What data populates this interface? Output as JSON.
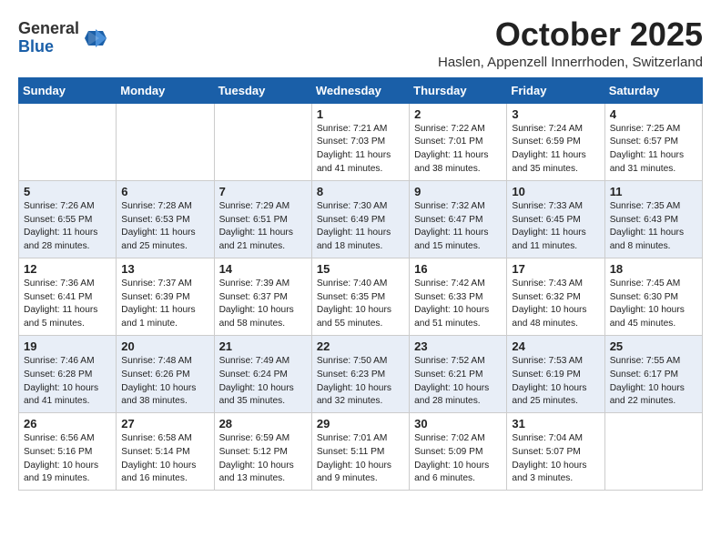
{
  "header": {
    "logo_general": "General",
    "logo_blue": "Blue",
    "month_title": "October 2025",
    "subtitle": "Haslen, Appenzell Innerrhoden, Switzerland"
  },
  "days_of_week": [
    "Sunday",
    "Monday",
    "Tuesday",
    "Wednesday",
    "Thursday",
    "Friday",
    "Saturday"
  ],
  "weeks": [
    [
      {
        "day": "",
        "content": ""
      },
      {
        "day": "",
        "content": ""
      },
      {
        "day": "",
        "content": ""
      },
      {
        "day": "1",
        "content": "Sunrise: 7:21 AM\nSunset: 7:03 PM\nDaylight: 11 hours and 41 minutes."
      },
      {
        "day": "2",
        "content": "Sunrise: 7:22 AM\nSunset: 7:01 PM\nDaylight: 11 hours and 38 minutes."
      },
      {
        "day": "3",
        "content": "Sunrise: 7:24 AM\nSunset: 6:59 PM\nDaylight: 11 hours and 35 minutes."
      },
      {
        "day": "4",
        "content": "Sunrise: 7:25 AM\nSunset: 6:57 PM\nDaylight: 11 hours and 31 minutes."
      }
    ],
    [
      {
        "day": "5",
        "content": "Sunrise: 7:26 AM\nSunset: 6:55 PM\nDaylight: 11 hours and 28 minutes."
      },
      {
        "day": "6",
        "content": "Sunrise: 7:28 AM\nSunset: 6:53 PM\nDaylight: 11 hours and 25 minutes."
      },
      {
        "day": "7",
        "content": "Sunrise: 7:29 AM\nSunset: 6:51 PM\nDaylight: 11 hours and 21 minutes."
      },
      {
        "day": "8",
        "content": "Sunrise: 7:30 AM\nSunset: 6:49 PM\nDaylight: 11 hours and 18 minutes."
      },
      {
        "day": "9",
        "content": "Sunrise: 7:32 AM\nSunset: 6:47 PM\nDaylight: 11 hours and 15 minutes."
      },
      {
        "day": "10",
        "content": "Sunrise: 7:33 AM\nSunset: 6:45 PM\nDaylight: 11 hours and 11 minutes."
      },
      {
        "day": "11",
        "content": "Sunrise: 7:35 AM\nSunset: 6:43 PM\nDaylight: 11 hours and 8 minutes."
      }
    ],
    [
      {
        "day": "12",
        "content": "Sunrise: 7:36 AM\nSunset: 6:41 PM\nDaylight: 11 hours and 5 minutes."
      },
      {
        "day": "13",
        "content": "Sunrise: 7:37 AM\nSunset: 6:39 PM\nDaylight: 11 hours and 1 minute."
      },
      {
        "day": "14",
        "content": "Sunrise: 7:39 AM\nSunset: 6:37 PM\nDaylight: 10 hours and 58 minutes."
      },
      {
        "day": "15",
        "content": "Sunrise: 7:40 AM\nSunset: 6:35 PM\nDaylight: 10 hours and 55 minutes."
      },
      {
        "day": "16",
        "content": "Sunrise: 7:42 AM\nSunset: 6:33 PM\nDaylight: 10 hours and 51 minutes."
      },
      {
        "day": "17",
        "content": "Sunrise: 7:43 AM\nSunset: 6:32 PM\nDaylight: 10 hours and 48 minutes."
      },
      {
        "day": "18",
        "content": "Sunrise: 7:45 AM\nSunset: 6:30 PM\nDaylight: 10 hours and 45 minutes."
      }
    ],
    [
      {
        "day": "19",
        "content": "Sunrise: 7:46 AM\nSunset: 6:28 PM\nDaylight: 10 hours and 41 minutes."
      },
      {
        "day": "20",
        "content": "Sunrise: 7:48 AM\nSunset: 6:26 PM\nDaylight: 10 hours and 38 minutes."
      },
      {
        "day": "21",
        "content": "Sunrise: 7:49 AM\nSunset: 6:24 PM\nDaylight: 10 hours and 35 minutes."
      },
      {
        "day": "22",
        "content": "Sunrise: 7:50 AM\nSunset: 6:23 PM\nDaylight: 10 hours and 32 minutes."
      },
      {
        "day": "23",
        "content": "Sunrise: 7:52 AM\nSunset: 6:21 PM\nDaylight: 10 hours and 28 minutes."
      },
      {
        "day": "24",
        "content": "Sunrise: 7:53 AM\nSunset: 6:19 PM\nDaylight: 10 hours and 25 minutes."
      },
      {
        "day": "25",
        "content": "Sunrise: 7:55 AM\nSunset: 6:17 PM\nDaylight: 10 hours and 22 minutes."
      }
    ],
    [
      {
        "day": "26",
        "content": "Sunrise: 6:56 AM\nSunset: 5:16 PM\nDaylight: 10 hours and 19 minutes."
      },
      {
        "day": "27",
        "content": "Sunrise: 6:58 AM\nSunset: 5:14 PM\nDaylight: 10 hours and 16 minutes."
      },
      {
        "day": "28",
        "content": "Sunrise: 6:59 AM\nSunset: 5:12 PM\nDaylight: 10 hours and 13 minutes."
      },
      {
        "day": "29",
        "content": "Sunrise: 7:01 AM\nSunset: 5:11 PM\nDaylight: 10 hours and 9 minutes."
      },
      {
        "day": "30",
        "content": "Sunrise: 7:02 AM\nSunset: 5:09 PM\nDaylight: 10 hours and 6 minutes."
      },
      {
        "day": "31",
        "content": "Sunrise: 7:04 AM\nSunset: 5:07 PM\nDaylight: 10 hours and 3 minutes."
      },
      {
        "day": "",
        "content": ""
      }
    ]
  ]
}
